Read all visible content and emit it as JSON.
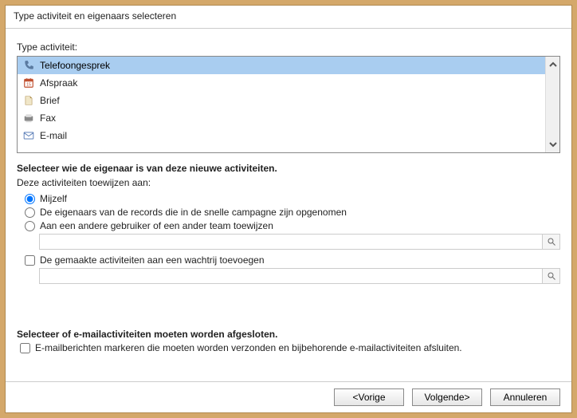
{
  "window": {
    "title": "Type activiteit en eigenaars selecteren"
  },
  "type_section": {
    "label": "Type activiteit:"
  },
  "activity_items": [
    {
      "icon": "phone",
      "label": "Telefoongesprek",
      "selected": true
    },
    {
      "icon": "calendar",
      "label": "Afspraak",
      "selected": false
    },
    {
      "icon": "letter",
      "label": "Brief",
      "selected": false
    },
    {
      "icon": "fax",
      "label": "Fax",
      "selected": false
    },
    {
      "icon": "mail",
      "label": "E-mail",
      "selected": false
    }
  ],
  "owner_section": {
    "title": "Selecteer wie de eigenaar is van deze nieuwe activiteiten.",
    "subtitle": "Deze activiteiten toewijzen aan:",
    "radios": {
      "myself": "Mijzelf",
      "record_owners": "De eigenaars van de records die in de snelle campagne zijn opgenomen",
      "other_user": "Aan een andere gebruiker of een ander team toewijzen"
    },
    "checkbox_queue": "De gemaakte activiteiten aan een wachtrij toevoegen",
    "lookup1_value": "",
    "lookup2_value": ""
  },
  "email_section": {
    "title": "Selecteer of e-mailactiviteiten moeten worden afgesloten.",
    "checkbox": "E-mailberichten markeren die moeten worden verzonden en bijbehorende e-mailactiviteiten afsluiten."
  },
  "footer": {
    "back": "<Vorige",
    "next": "Volgende>",
    "cancel": "Annuleren"
  }
}
